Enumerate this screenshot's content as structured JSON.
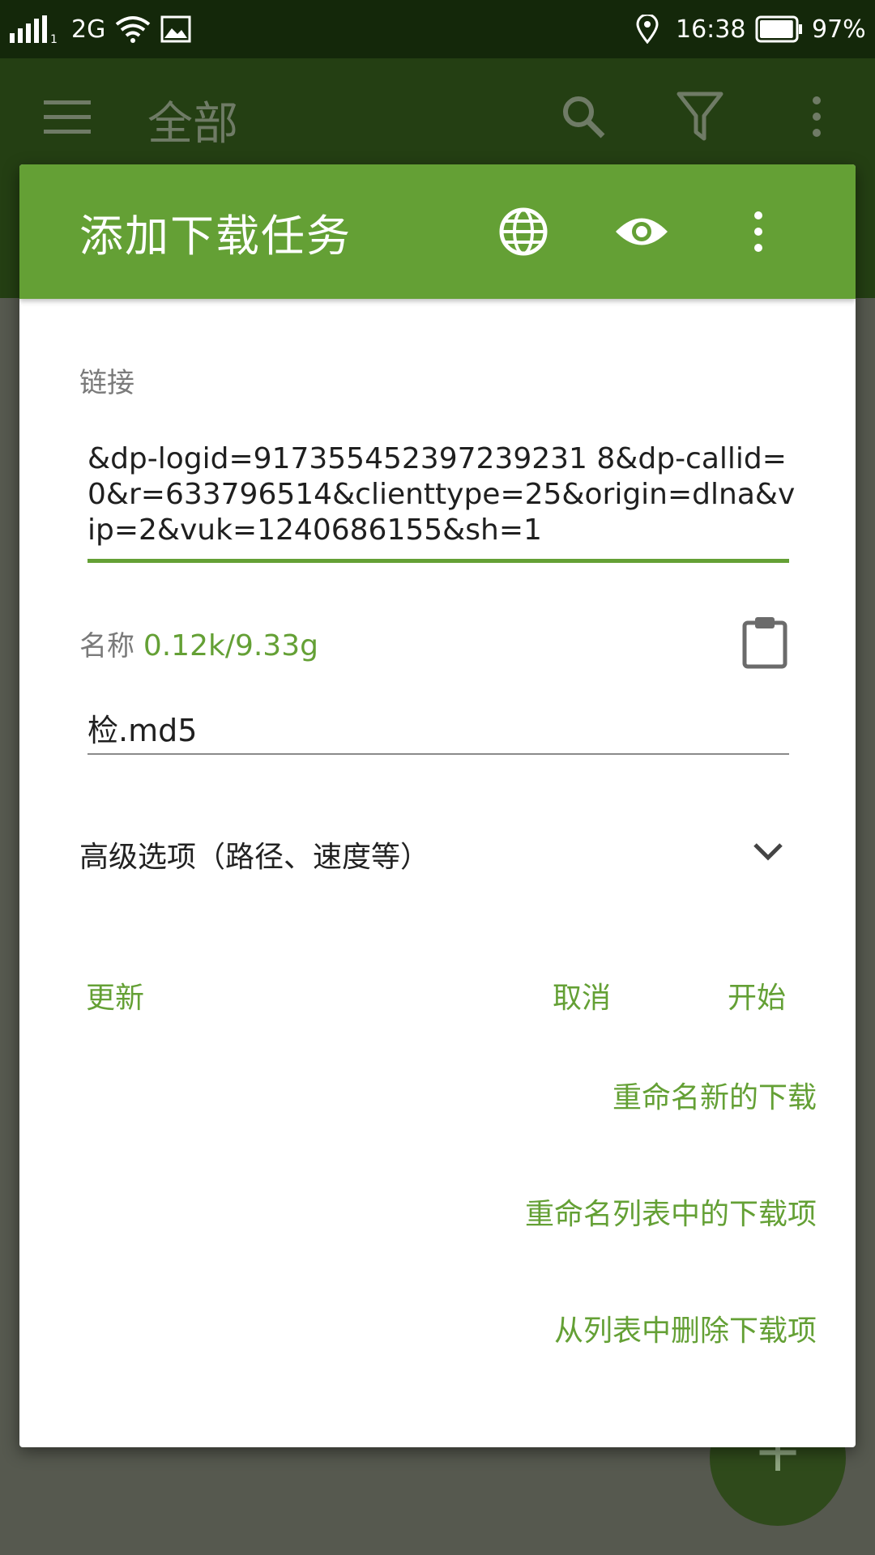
{
  "status_bar": {
    "network_type": "2G",
    "time": "16:38",
    "battery_percent": "97%",
    "battery_level": 0.97,
    "icons": [
      "signal-icon",
      "wifi-icon",
      "image-icon",
      "location-icon",
      "battery-icon"
    ]
  },
  "app_bar": {
    "title": "全部",
    "icons": [
      "menu-icon",
      "search-icon",
      "filter-icon",
      "more-vert-icon"
    ]
  },
  "dialog": {
    "title": "添加下载任务",
    "header_icons": [
      "globe-icon",
      "eye-icon",
      "more-vert-icon"
    ],
    "link_label": "链接",
    "link_value": "&dp-logid=917355452397239231 8&dp-callid=0&r=633796514&clienttype=25&origin=dlna&vip=2&vuk=1240686155&sh=1",
    "name_label": "名称",
    "name_stat": "0.12k/9.33g",
    "name_value": "检.md5",
    "advanced_label": "高级选项（路径、速度等）",
    "buttons": {
      "update": "更新",
      "cancel": "取消",
      "start": "开始"
    },
    "menu": [
      "重命名新的下载",
      "重命名列表中的下载项",
      "从列表中删除下载项"
    ]
  },
  "colors": {
    "accent": "#64a035",
    "status_bar_bg": "#14280a",
    "app_bar_bg": "#243f13"
  }
}
